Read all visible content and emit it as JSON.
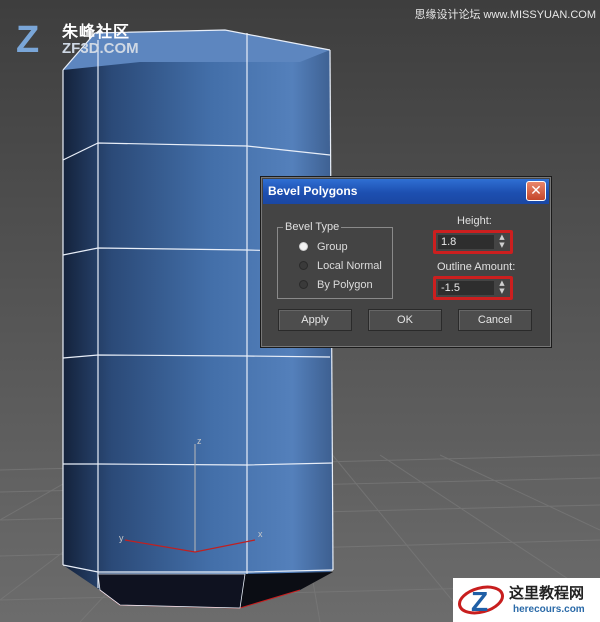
{
  "watermarks": {
    "site_cn": "朱峰社区",
    "site_en": "ZF3D.COM",
    "right_top": "思缘设计论坛 www.MISSYUAN.COM",
    "bottom_cn": "这里教程网",
    "bottom_en": "herecours.com"
  },
  "viewport": {
    "axis_z": "z",
    "axis_y": "y",
    "axis_x": "x"
  },
  "dialog": {
    "title": "Bevel Polygons",
    "close_label": "✕",
    "bevel_type_label": "Bevel Type",
    "options": [
      "Group",
      "Local Normal",
      "By Polygon"
    ],
    "selected_option": "Group",
    "height_label": "Height:",
    "height_value": "1.8",
    "outline_label": "Outline Amount:",
    "outline_value": "-1.5",
    "apply_label": "Apply",
    "ok_label": "OK",
    "cancel_label": "Cancel"
  },
  "colors": {
    "highlight": "#cc1f1f",
    "titlebar": "#2063c9",
    "mesh": "#3f6aa4"
  }
}
